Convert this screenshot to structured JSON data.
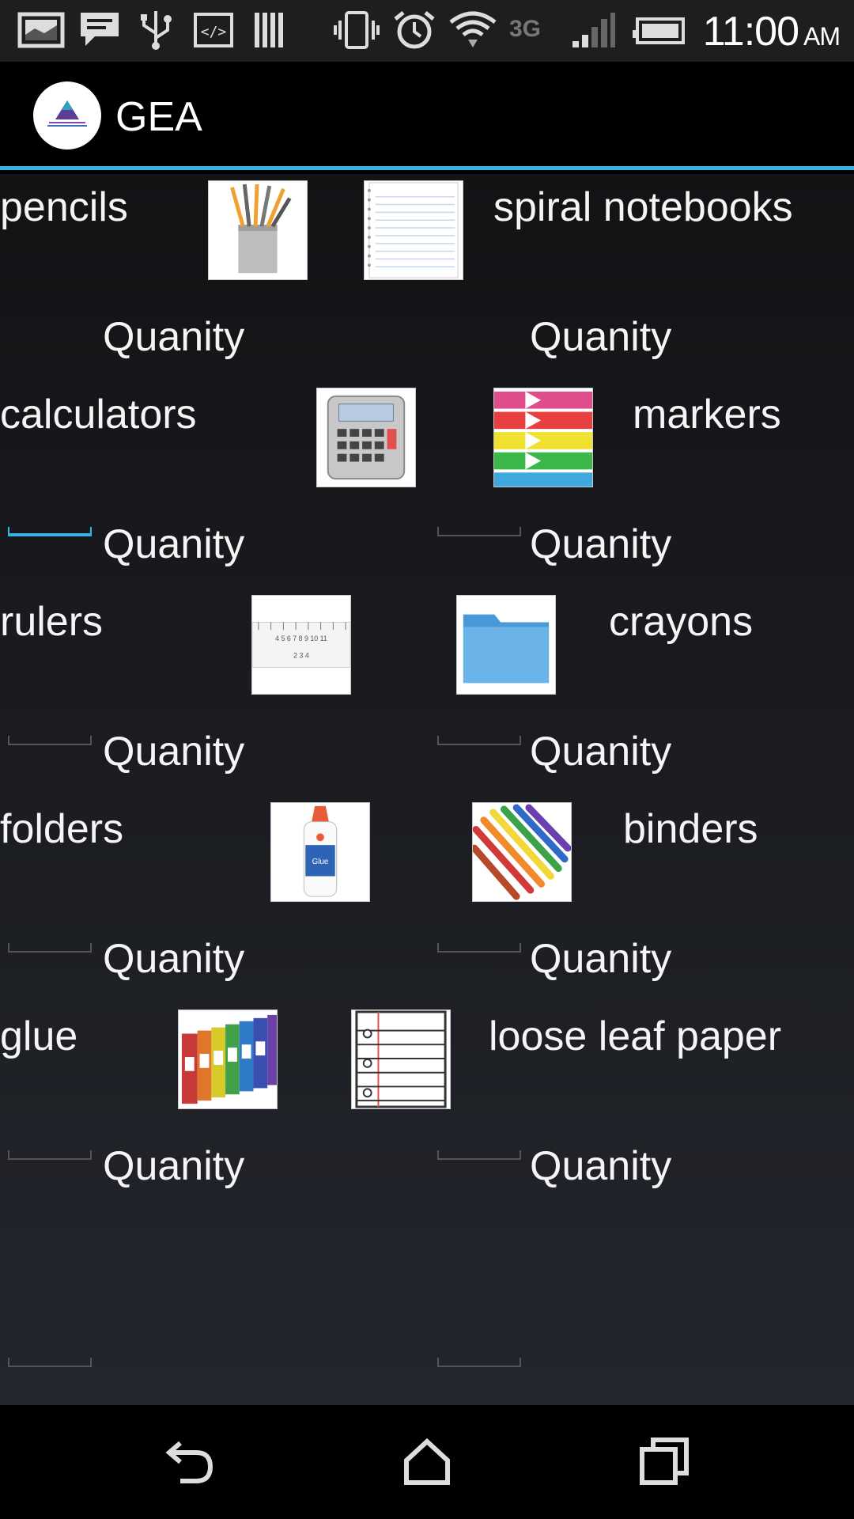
{
  "status_bar": {
    "time": "11:00",
    "ampm": "AM",
    "network": "3G",
    "icons": [
      "gallery-icon",
      "message-icon",
      "usb-icon",
      "code-icon",
      "barcode-icon",
      "vibrate-icon",
      "alarm-icon",
      "wifi-icon",
      "network-3g-icon",
      "signal-icon",
      "battery-icon"
    ]
  },
  "app": {
    "title": "GEA",
    "logo": "guilford-education-alliance-logo"
  },
  "items": [
    {
      "name": "pencils",
      "image": "pencils-cup-image",
      "qty_label": "Quanity"
    },
    {
      "name": "spiral notebooks",
      "image": "spiral-notebook-image",
      "qty_label": "Quanity"
    },
    {
      "name": "calculators",
      "image": "calculator-image",
      "qty_label": "Quanity"
    },
    {
      "name": "markers",
      "image": "markers-image",
      "qty_label": "Quanity"
    },
    {
      "name": "rulers",
      "image": "ruler-image",
      "qty_label": "Quanity"
    },
    {
      "name": "crayons",
      "image": "folder-image",
      "qty_label": "Quanity"
    },
    {
      "name": "folders",
      "image": "glue-bottle-image",
      "qty_label": "Quanity"
    },
    {
      "name": "binders",
      "image": "crayons-image",
      "qty_label": "Quanity"
    },
    {
      "name": "glue",
      "image": "binders-image",
      "qty_label": "Quanity"
    },
    {
      "name": "loose leaf paper",
      "image": "loose-leaf-paper-image",
      "qty_label": "Quanity"
    }
  ],
  "nav": [
    "back-icon",
    "home-icon",
    "recents-icon"
  ]
}
